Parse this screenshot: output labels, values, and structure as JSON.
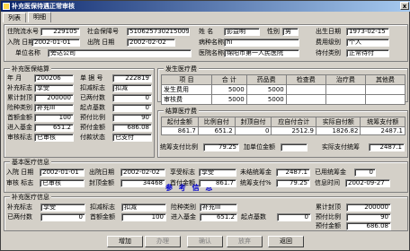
{
  "window": {
    "title": "补充医保待遇正常审核",
    "close": "x"
  },
  "tabs": [
    {
      "label": "列表"
    },
    {
      "label": "明细"
    }
  ],
  "top": {
    "zyls_label": "住院流水号",
    "zyls": "229105",
    "sbh_label": "社会保障号",
    "sbh": "510625730215009",
    "xm_label": "姓 名",
    "xm": "彭益明",
    "xb_label": "性别",
    "xb": "男",
    "csrq_label": "出生日期",
    "csrq": "1973-02-15",
    "ry_label": "入院 日期",
    "ry": "2002-01-01",
    "cy_label": "出院 日期",
    "cy": "2002-02-02",
    "bzmc_label": "病种名称",
    "bzmc": "hi",
    "fylb_label": "费用级别",
    "fylb": "个人",
    "dwmc_label": "单位名称",
    "dwmc": "旁达公司",
    "yymc_label": "医院名称",
    "yymc": "绵阳市第一人民医院",
    "lylb_label": "待付类别",
    "lylb": "正常待付"
  },
  "settle": {
    "title": "补充医保结算",
    "nf_label": "年 月",
    "nf": "200206",
    "djh_label": "单 据 号",
    "djh": "222819",
    "bcbz_label": "补充标志",
    "bcbz": "享受",
    "kjbz_label": "扣减标志",
    "kjbz": "扣减",
    "ljfd_label": "累计封顶",
    "ljfd": "200000",
    "yzf_label": "已两付数",
    "yzf": "0",
    "xbfl_label": "险种类别",
    "xbfl": "补充III",
    "qzbz_label": "起点基数",
    "qzbz": "0",
    "sczf_label": "首额金额",
    "sczf": "100",
    "ydbl_label": "预付比例",
    "ydbl": "90",
    "jrzf_label": "进入基金",
    "jrzf": "651.2",
    "bcfz_label": "预付金额",
    "bcfz": "686.08",
    "shbz_label": "审核标志",
    "shbz": "已审核",
    "zfbz_label": "付款状态",
    "zfbz": "已支付"
  },
  "fees": {
    "title": "发生医疗费",
    "cols": [
      "项 目",
      "合 计",
      "药品费",
      "检查费",
      "治疗费",
      "其他费"
    ],
    "rows": [
      [
        "发生费用",
        "5000",
        "5000",
        "",
        "",
        ""
      ],
      [
        "审核费",
        "5000",
        "5000",
        "",
        "",
        ""
      ]
    ]
  },
  "result": {
    "title": "结算医疗费",
    "cols": [
      "起付金额",
      "比例自付",
      "封顶自付",
      "应自付合计",
      "实际自付额",
      "统筹支付额"
    ],
    "row": [
      "861.7",
      "651.2",
      "0",
      "2512.9",
      "1826.82",
      "2487.1"
    ],
    "tczf_label": "统筹支付比例",
    "tczf": "79.25",
    "jrdw_label": "加单位金额",
    "jrdw": "",
    "sjtc_label": "实际支付统筹",
    "sjtc": "2487.1"
  },
  "basic": {
    "title": "基本医疗信息",
    "heading": "参 考 信 息",
    "ry_label": "入院 日期",
    "ry": "2002-01-01",
    "cy_label": "出院日期",
    "cy": "2002-02-02",
    "xsbz_label": "享受标志",
    "xsbz": "享受",
    "wjtc_label": "未结统筹金",
    "wjtc": "2487.1",
    "yjtc_label": "已用统筹金",
    "yjtc": "0",
    "sh_label": "审核 标志",
    "sh": "已审核",
    "fdje_label": "封顶金额",
    "fdje": "34468",
    "sfje_label": "首付金额",
    "sfje": "861.7",
    "tczfbl_label": "统筹支付%",
    "tczfbl": "79.25",
    "xxsj_label": "信息时间",
    "xxsj": "2002-09-27"
  },
  "supp": {
    "title": "补充医疗信息",
    "bcbz_label": "补充标志",
    "bcbz": "享受",
    "kjbz_label": "扣减标志",
    "kjbz": "扣减",
    "xzlb_label": "险种类别",
    "xzlb": "补充III",
    "ljfd_label": "累计封顶",
    "ljfd": "200000",
    "yzfs_label": "已两付数",
    "yzfs": "0",
    "sfje_label": "首额金额",
    "sfje": "100",
    "jrjj_label": "进入基金",
    "jrjj": "651.2",
    "qdjs_label": "起点基数",
    "qdjs": "0",
    "ydbl_label": "预付比例",
    "ydbl": "90",
    "ydje_label": "预付金额",
    "ydje": "686.08"
  },
  "buttons": {
    "add": "增加",
    "modify": "办理",
    "confirm": "确认",
    "cancel": "放弃",
    "back": "返回"
  }
}
